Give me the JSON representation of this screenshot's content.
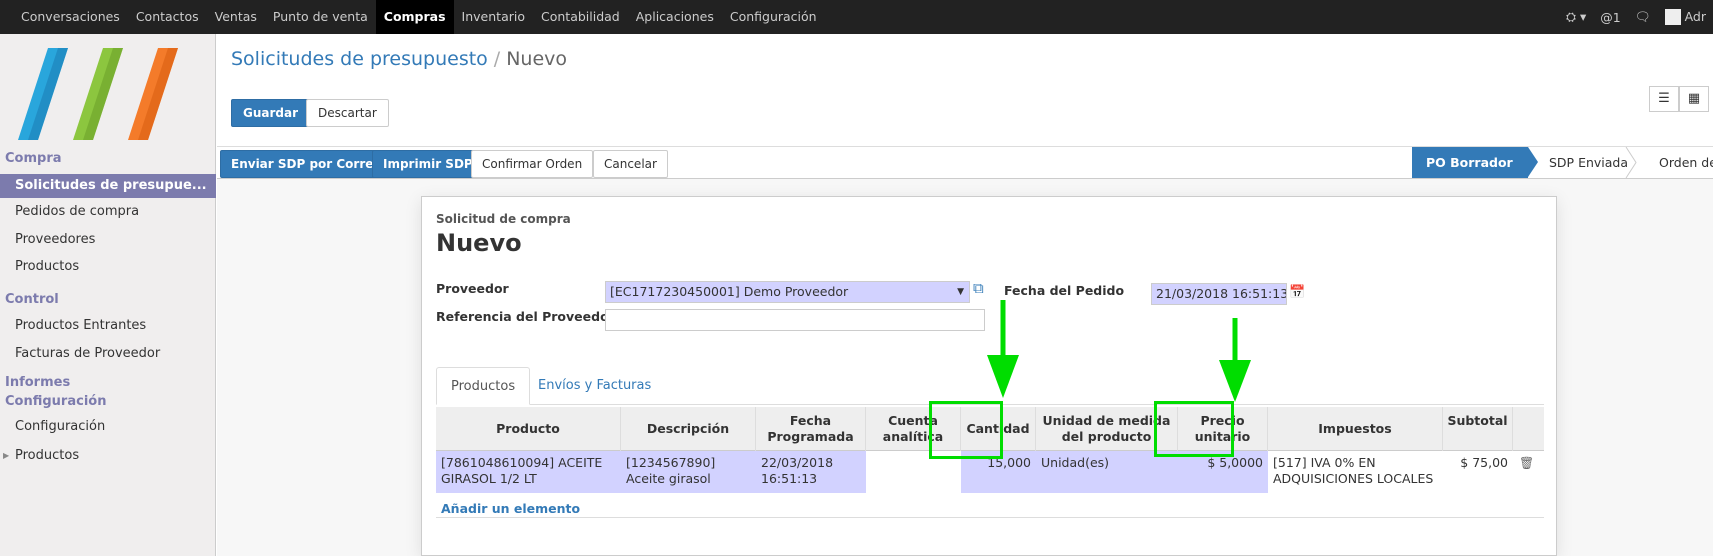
{
  "topbar": {
    "menu": [
      "Conversaciones",
      "Contactos",
      "Ventas",
      "Punto de venta",
      "Compras",
      "Inventario",
      "Contabilidad",
      "Aplicaciones",
      "Configuración"
    ],
    "active_index": 4,
    "messages_count": "1",
    "user_label": "Adr"
  },
  "sidebar": {
    "section_compra": "Compra",
    "compra_items": [
      "Solicitudes de presupue...",
      "Pedidos de compra",
      "Proveedores",
      "Productos"
    ],
    "section_control": "Control",
    "control_items": [
      "Productos Entrantes",
      "Facturas de Proveedor"
    ],
    "section_informes": "Informes",
    "section_config": "Configuración",
    "config_items": [
      "Configuración",
      "Productos"
    ]
  },
  "breadcrumb": {
    "parent": "Solicitudes de presupuesto",
    "separator": "/",
    "current": "Nuevo"
  },
  "buttons": {
    "save": "Guardar",
    "discard": "Descartar"
  },
  "statusbar": {
    "actions": [
      "Enviar SDP por Correo",
      "Imprimir SDP",
      "Confirmar Orden",
      "Cancelar"
    ],
    "stages": [
      "PO Borrador",
      "SDP Enviada",
      "Orden de c"
    ]
  },
  "form": {
    "subtitle": "Solicitud de compra",
    "title": "Nuevo",
    "supplier_label": "Proveedor",
    "supplier_value": "[EC1717230450001] Demo Proveedor",
    "supplier_ref_label": "Referencia del Proveedor",
    "supplier_ref_value": "",
    "order_date_label": "Fecha del Pedido",
    "order_date_value": "21/03/2018 16:51:13"
  },
  "tabs": [
    "Productos",
    "Envíos y Facturas"
  ],
  "table": {
    "headers": {
      "product": "Producto",
      "description": "Descripción",
      "date_line1": "Fecha",
      "date_line2": "Programada",
      "account_line1": "Cuenta",
      "account_line2": "analítica",
      "qty": "Cantidad",
      "uom_line1": "Unidad de medida",
      "uom_line2": "del producto",
      "price_line1": "Precio",
      "price_line2": "unitario",
      "taxes": "Impuestos",
      "subtotal": "Subtotal"
    },
    "row": {
      "product": "[7861048610094] ACEITE GIRASOL 1/2 LT",
      "description": "[1234567890] Aceite girasol",
      "date": "22/03/2018 16:51:13",
      "account": "",
      "qty": "15,000",
      "uom": "Unidad(es)",
      "price": "$ 5,0000",
      "taxes": "[517] IVA 0% EN ADQUISICIONES LOCALES",
      "subtotal": "$ 75,00"
    },
    "add_line": "Añadir un elemento"
  },
  "colors": {
    "accent": "#337ab7",
    "sidebar_active": "#7c7bad",
    "highlight": "#00dd00"
  }
}
